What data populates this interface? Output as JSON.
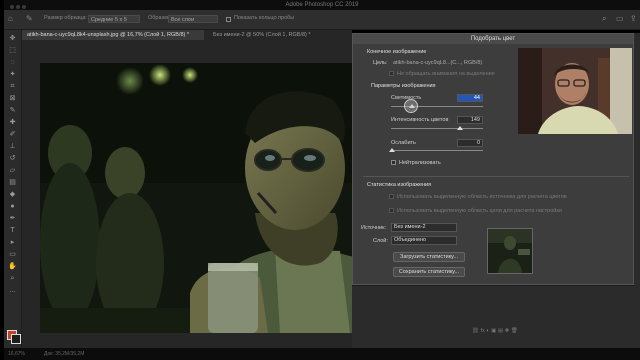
{
  "app": {
    "title": "Adobe Photoshop CC 2019"
  },
  "options_bar": {
    "sample_size_label": "Размер образца:",
    "sample_size_value": "Средние 5 х 5",
    "sample_label": "Образец:",
    "sample_value": "Все слои",
    "show_ring_label": "Показать кольцо пробы"
  },
  "document_tabs": [
    {
      "label": "atikh-bana-c-uyc9qL8k4-unsplash.jpg @ 16,7% (Слой 1, RGB/8) *"
    },
    {
      "label": "Без имени-2 @ 50% (Слой 1, RGB/8) *"
    }
  ],
  "dialog": {
    "title": "Подобрать цвет",
    "target_section": "Конечное изображение",
    "target_label": "Цель:",
    "target_value": "atikh-bana-c-uyc9qL8...(С..., RGB/8)",
    "ignore_selection": "Не обращать внимания на выделение",
    "options_section": "Параметры изображения",
    "luminance_label": "Светимость",
    "luminance_value": "44",
    "intensity_label": "Интенсивность цветов",
    "intensity_value": "149",
    "fade_label": "Ослабить",
    "fade_value": "0",
    "neutralize_label": "Нейтрализовать",
    "stats_section": "Статистика изображения",
    "use_sel_source": "Использовать выделенную область источника для расчета цветов",
    "use_sel_target": "Использовать выделенную область цели для расчета настройки",
    "source_label": "Источник:",
    "source_value": "Без имени-2",
    "layer_label": "Слой:",
    "layer_value": "Объединено",
    "load_stats_button": "Загрузить статистику...",
    "save_stats_button": "Сохранить статистику..."
  },
  "status_bar": {
    "zoom": "16,67%",
    "doc_info": "Док: 35,2М/35,2М"
  },
  "colors": {
    "foreground": "#c0442e",
    "background": "#1e1e1e",
    "highlight": "#2456b8"
  }
}
